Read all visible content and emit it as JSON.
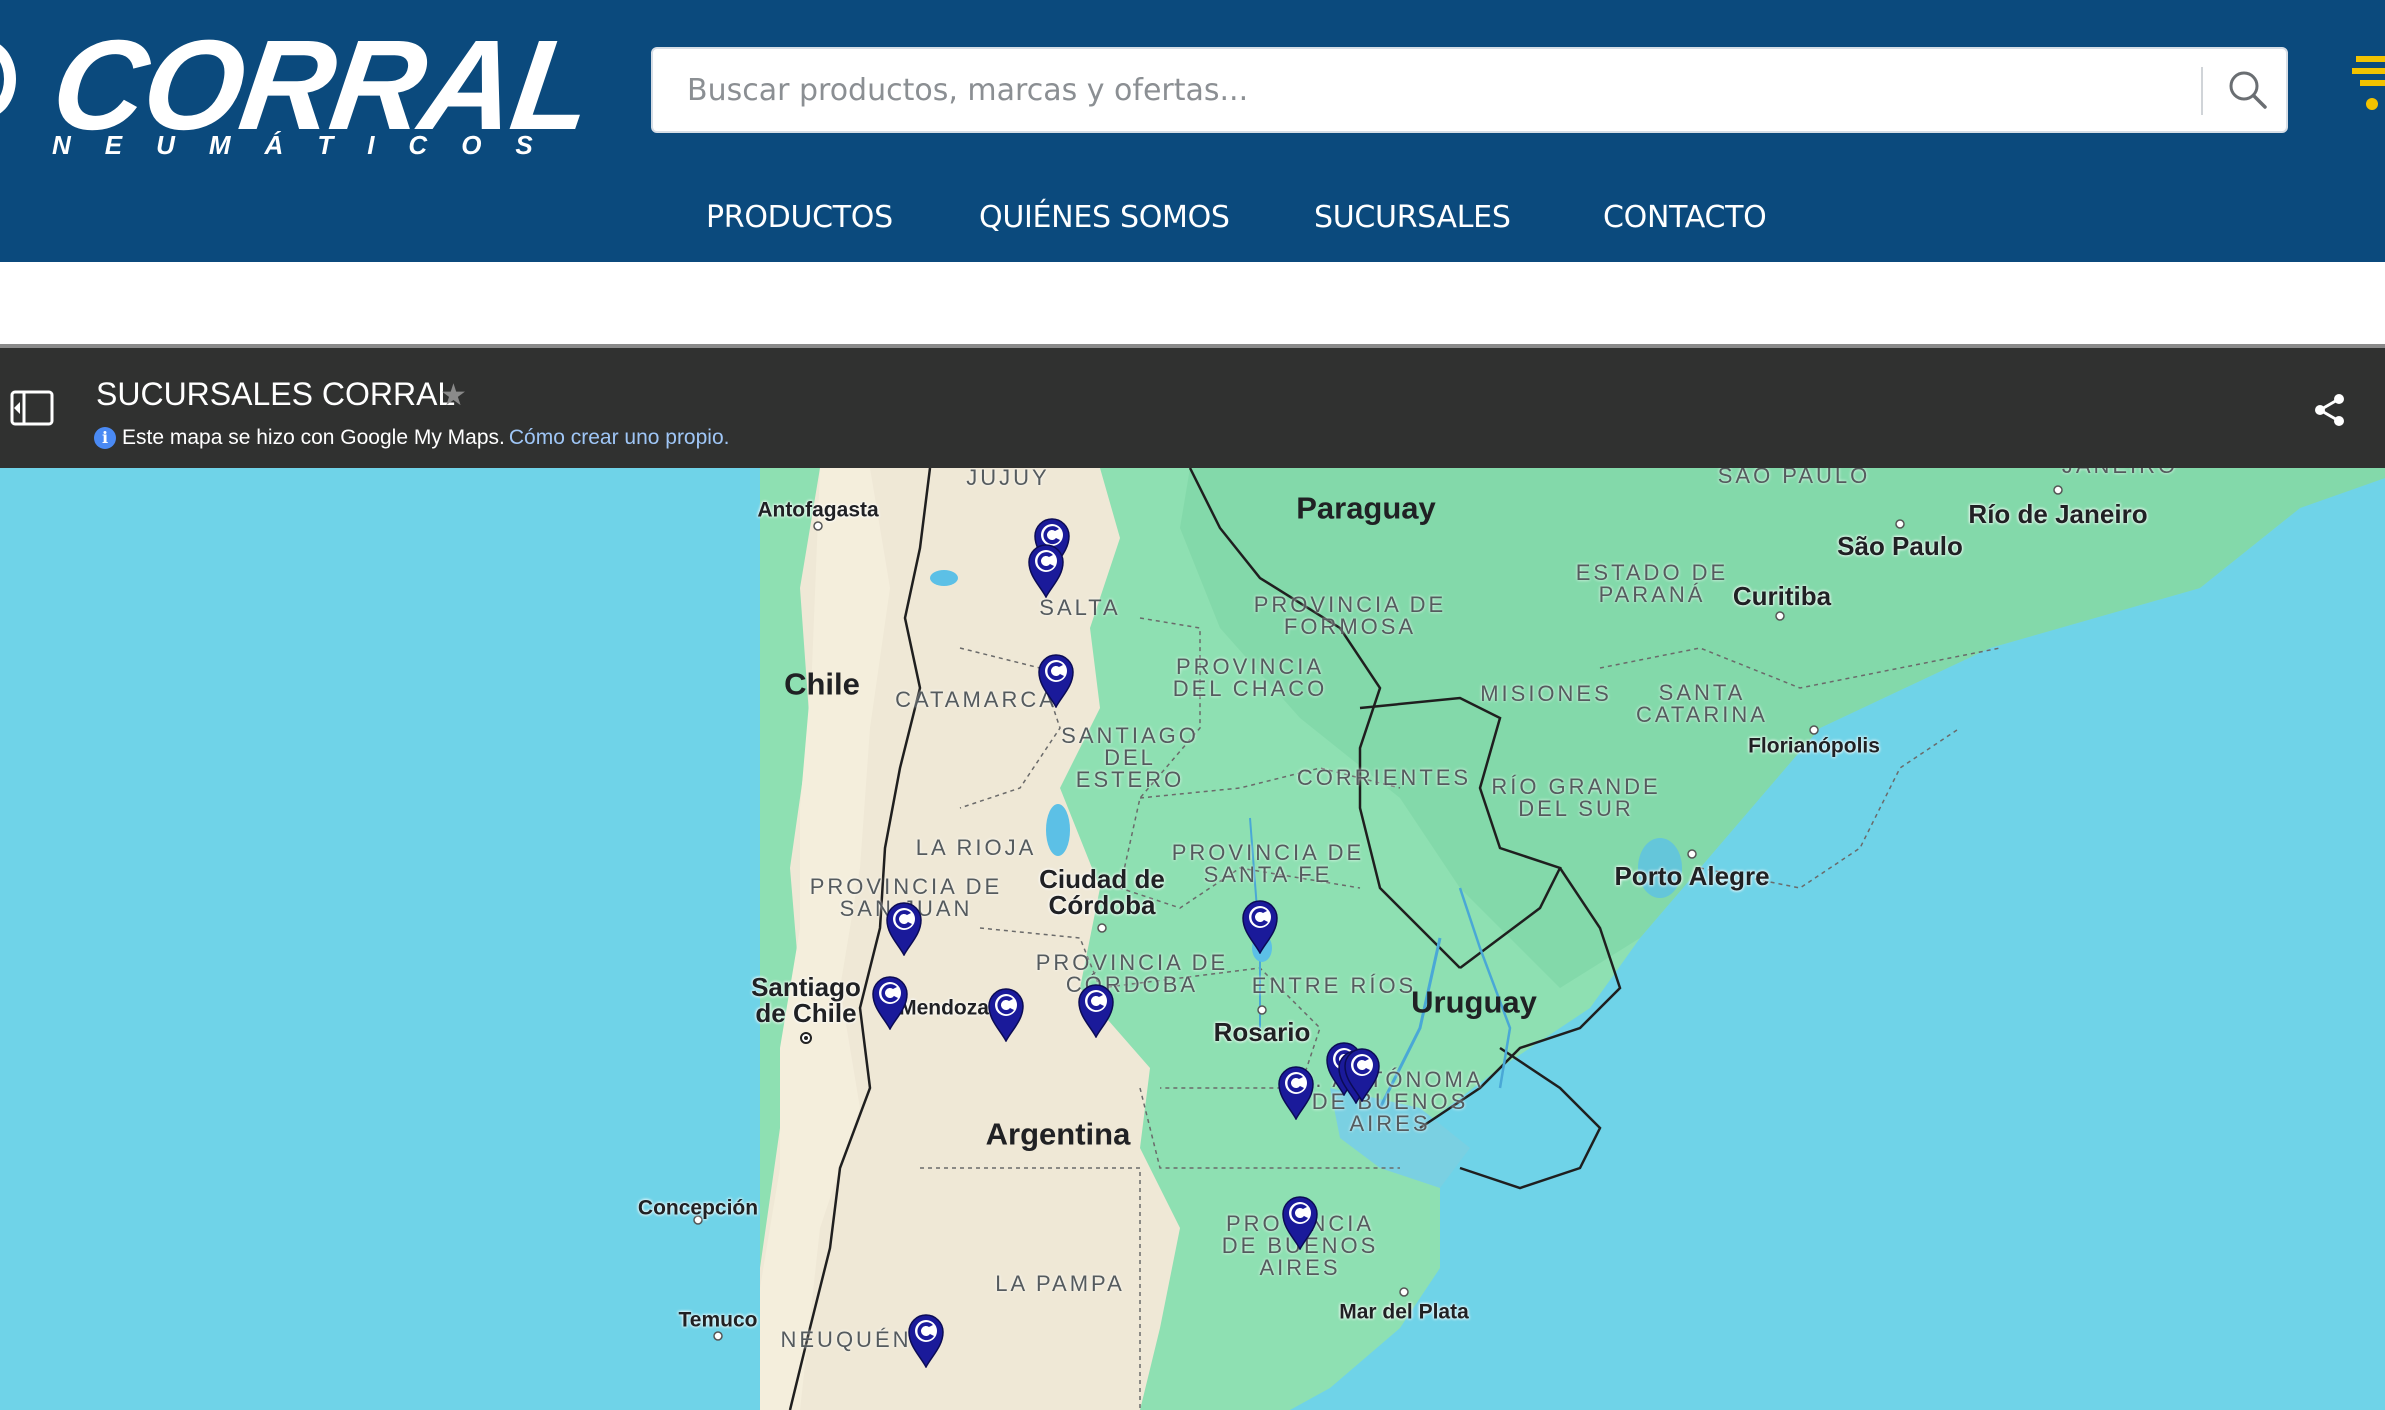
{
  "header": {
    "logo_text": "CORRAL",
    "logo_subtext": "NEUMÁTICOS",
    "search_placeholder": "Buscar productos, marcas y ofertas...",
    "nav": [
      "PRODUCTOS",
      "QUIÉNES SOMOS",
      "SUCURSALES",
      "CONTACTO"
    ],
    "colors": {
      "header_bg": "#0b4a7d",
      "accent": "#f2c200"
    }
  },
  "mymaps": {
    "title": "SUCURSALES CORRAL",
    "info_text": "Este mapa se hizo con Google My Maps.",
    "info_link": "Cómo crear uno propio.",
    "icons": [
      "side-panel-icon",
      "star-icon",
      "info-icon",
      "share-icon"
    ]
  },
  "map": {
    "countries": [
      "Paraguay",
      "Chile",
      "Argentina",
      "Uruguay"
    ],
    "cities": [
      "Antofagasta",
      "São Paulo",
      "Río de Janeiro",
      "Curitiba",
      "Florianópolis",
      "Porto Alegre",
      "Ciudad de Córdoba",
      "Santiago de Chile",
      "Mendoza",
      "Rosario",
      "Concepción",
      "Temuco",
      "Mar del Plata"
    ],
    "regions": [
      "JUJUY",
      "SALTA",
      "CATAMARCA",
      "PROVINCIA DE FORMOSA",
      "PROVINCIA DEL CHACO",
      "SANTIAGO DEL ESTERO",
      "CORRIENTES",
      "MISIONES",
      "LA RIOJA",
      "PROVINCIA DE SAN JUAN",
      "PROVINCIA DE SANTA FE",
      "PROVINCIA DE CÓRDOBA",
      "ENTRE RÍOS",
      "LA PAMPA",
      "PROVINCIA DE BUENOS AIRES",
      "NEUQUÉN",
      "SAO PAULO",
      "JANEIRO",
      "ESTADO DE PARANÁ",
      "SANTA CATARINA",
      "RÍO GRANDE DEL SUR",
      "D. AUTÓNOMA DE BUENOS AIRES"
    ],
    "marker_count": 16,
    "colors": {
      "sea": "#6fd3e8",
      "land_green": "#8ee0b2",
      "land_tan": "#efe8d6",
      "marker": "#1a1a9a"
    }
  }
}
